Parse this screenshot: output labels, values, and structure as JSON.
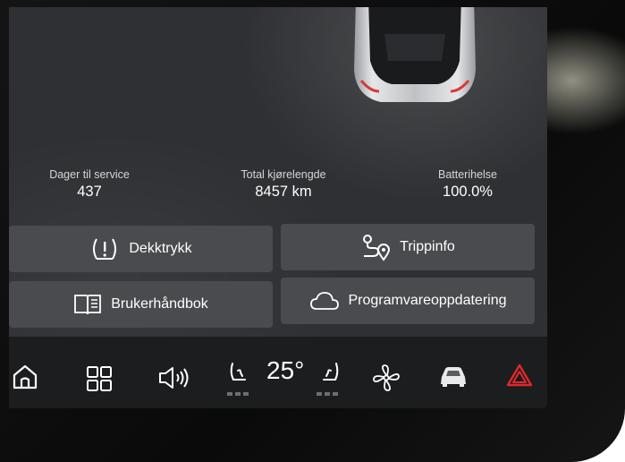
{
  "stats": {
    "service": {
      "label": "Dager til service",
      "value": "437"
    },
    "odometer": {
      "label": "Total kjørelengde",
      "value": "8457 km"
    },
    "battery": {
      "label": "Batterihelse",
      "value": "100.0%"
    }
  },
  "tiles": {
    "tire_pressure": "Dekktrykk",
    "trip_info": "Trippinfo",
    "manual": "Brukerhåndbok",
    "software_update": "Programvareoppdatering"
  },
  "dock": {
    "temperature": "25°",
    "icons": [
      "home-icon",
      "apps-grid-icon",
      "volume-icon",
      "seat-heat-left-icon",
      "seat-heat-right-icon",
      "fan-icon",
      "car-icon",
      "hazard-icon"
    ],
    "hazard_color": "#e0282c"
  }
}
